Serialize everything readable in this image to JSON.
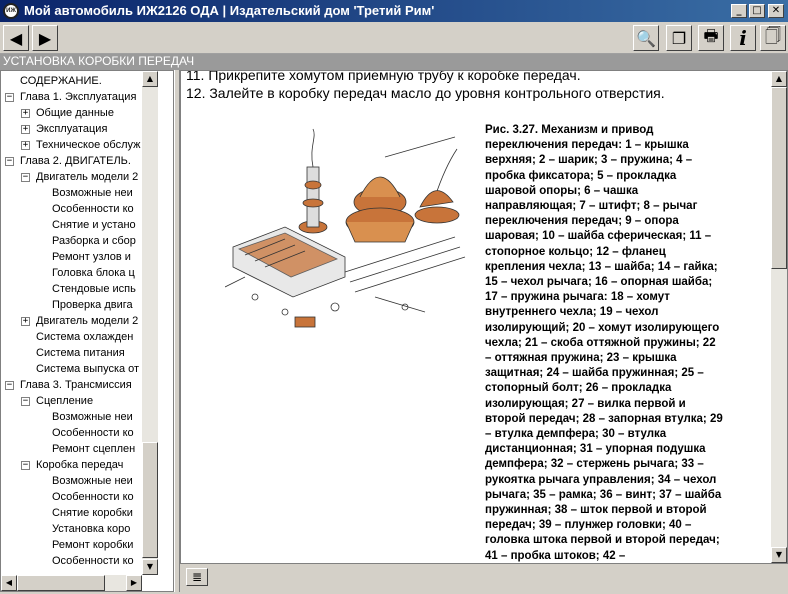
{
  "window": {
    "title": "Мой автомобиль ИЖ2126 ОДА | Издательский дом 'Третий Рим'",
    "app_icon_text": "ИЖ",
    "controls": {
      "minimize": "_",
      "maximize": "□",
      "close": "✕"
    }
  },
  "toolbar": {
    "back_glyph": "◀",
    "forward_glyph": "▶",
    "search_glyph": "🔍",
    "copy_glyph": "❐",
    "print_glyph": "🖶",
    "info_glyph": "i",
    "export_glyph": "🗍"
  },
  "header": {
    "title": "УСТАНОВКА КОРОБКИ ПЕРЕДАЧ"
  },
  "tree": [
    {
      "label": "СОДЕРЖАНИЕ.",
      "level": 0,
      "toggle": ""
    },
    {
      "label": "Глава 1. Эксплуатация",
      "level": 0,
      "toggle": "−"
    },
    {
      "label": "Общие данные",
      "level": 1,
      "toggle": "+"
    },
    {
      "label": "Эксплуатация",
      "level": 1,
      "toggle": "+"
    },
    {
      "label": "Техническое обслуж",
      "level": 1,
      "toggle": "+"
    },
    {
      "label": "Глава 2. ДВИГАТЕЛЬ.",
      "level": 0,
      "toggle": "−"
    },
    {
      "label": "Двигатель модели 2",
      "level": 1,
      "toggle": "−"
    },
    {
      "label": "Возможные неи",
      "level": 2,
      "toggle": ""
    },
    {
      "label": "Особенности ко",
      "level": 2,
      "toggle": ""
    },
    {
      "label": "Снятие и устано",
      "level": 2,
      "toggle": ""
    },
    {
      "label": "Разборка и сбор",
      "level": 2,
      "toggle": ""
    },
    {
      "label": "Ремонт узлов и",
      "level": 2,
      "toggle": ""
    },
    {
      "label": "Головка блока ц",
      "level": 2,
      "toggle": ""
    },
    {
      "label": "Стендовые испь",
      "level": 2,
      "toggle": ""
    },
    {
      "label": "Проверка двига",
      "level": 2,
      "toggle": ""
    },
    {
      "label": "Двигатель модели 2",
      "level": 1,
      "toggle": "+"
    },
    {
      "label": "Система охлажден",
      "level": 1,
      "toggle": ""
    },
    {
      "label": "Система питания",
      "level": 1,
      "toggle": ""
    },
    {
      "label": "Система выпуска от",
      "level": 1,
      "toggle": ""
    },
    {
      "label": "Глава 3. Трансмиссия",
      "level": 0,
      "toggle": "−"
    },
    {
      "label": "Сцепление",
      "level": 1,
      "toggle": "−"
    },
    {
      "label": "Возможные неи",
      "level": 2,
      "toggle": ""
    },
    {
      "label": "Особенности ко",
      "level": 2,
      "toggle": ""
    },
    {
      "label": "Ремонт сцеплен",
      "level": 2,
      "toggle": ""
    },
    {
      "label": "Коробка передач",
      "level": 1,
      "toggle": "−"
    },
    {
      "label": "Возможные неи",
      "level": 2,
      "toggle": ""
    },
    {
      "label": "Особенности ко",
      "level": 2,
      "toggle": ""
    },
    {
      "label": "Снятие коробки",
      "level": 2,
      "toggle": ""
    },
    {
      "label": "Установка коро",
      "level": 2,
      "toggle": ""
    },
    {
      "label": "Ремонт коробки",
      "level": 2,
      "toggle": ""
    },
    {
      "label": "Особенности ко",
      "level": 2,
      "toggle": ""
    }
  ],
  "content": {
    "step11": "11. Прикрепите хомутом приемную трубу к коробке передач.",
    "step12": "12. Залейте в коробку передач масло до уровня контрольного отверстия.",
    "caption": "Рис. 3.27. Механизм и привод переключения передач: 1 – крышка верхняя; 2 – шарик; 3 – пружина; 4 – пробка фиксатора; 5 – прокладка шаровой опоры; 6 – чашка направляющая; 7 – штифт; 8 – рычаг переключения передач; 9 – опора шаровая; 10 – шайба сферическая; 11 – стопорное кольцо; 12 – фланец крепления чехла; 13 – шайба; 14 – гайка; 15 – чехол рычага; 16 – опорная шайба; 17 – пружина рычага: 18 – хомут внутреннего чехла; 19 – чехол изолирующий; 20 – хомут изолирующего чехла; 21 – скоба оттяжной пружины; 22 – оттяжная пружина; 23 – крышка защитная; 24 – шайба пружинная; 25 – стопорный болт; 26 – прокладка изолирующая; 27 – вилка первой и второй передач; 28 – запорная втулка; 29 – втулка демпфера; 30 – втулка дистанционная; 31 – упорная подушка демпфера; 32 – стержень рычага; 33 – рукоятка рычага управления; 34 – чехол рычага; 35 – рамка; 36 – винт; 37 – шайба пружинная; 38 – шток первой и второй передач; 39 – плунжер головки; 40 – головка штока первой и второй передач; 41 – пробка штоков; 42 –"
  },
  "status": {
    "doc_glyph": "≣"
  },
  "colors": {
    "title_start": "#0a246a",
    "title_end": "#3a6ea5",
    "header_bar": "#9a9a9a",
    "part_orange": "#c8743a"
  }
}
